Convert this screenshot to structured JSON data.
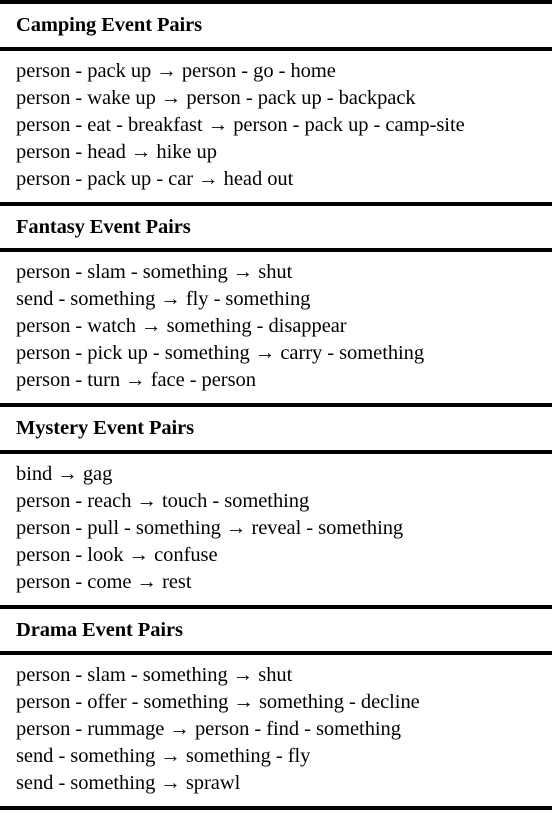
{
  "table": {
    "caption": "",
    "sections": [
      {
        "header": "Camping Event Pairs",
        "rows": [
          "person - pack up → person - go - home",
          "person - wake up → person - pack up - backpack",
          "person - eat - breakfast → person - pack up - camp-site",
          "person - head → hike up",
          "person - pack up - car → head out"
        ]
      },
      {
        "header": "Fantasy Event Pairs",
        "rows": [
          "person - slam - something → shut",
          "send - something → fly - something",
          "person - watch → something - disappear",
          "person - pick up - something → carry - something",
          "person - turn → face - person"
        ]
      },
      {
        "header": "Mystery Event Pairs",
        "rows": [
          "bind → gag",
          "person - reach → touch - something",
          "person - pull - something → reveal - something",
          "person - look → confuse",
          "person - come → rest"
        ]
      },
      {
        "header": "Drama Event Pairs",
        "rows": [
          "person - slam - something → shut",
          "person - offer - something → something - decline",
          "person - rummage → person - find - something",
          "send - something → something - fly",
          "send - something → sprawl"
        ]
      }
    ]
  }
}
